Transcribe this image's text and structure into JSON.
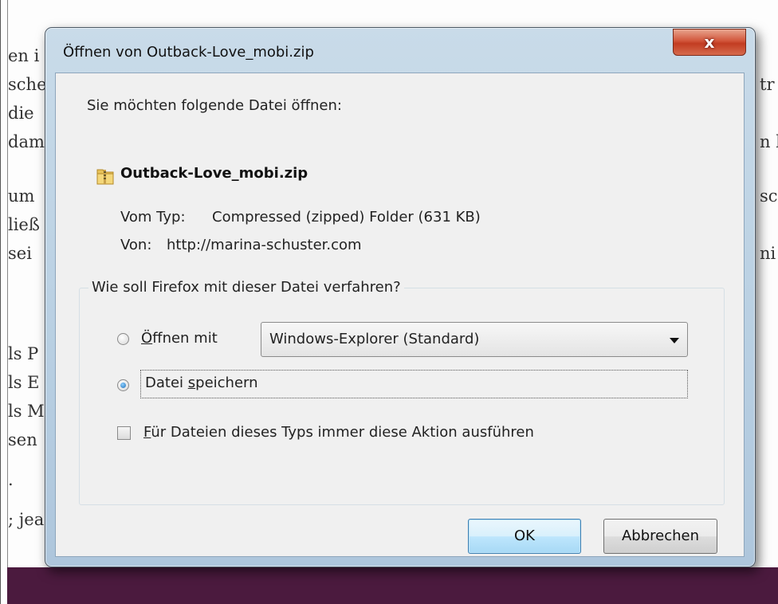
{
  "background": {
    "left_lines": [
      "en i",
      "sche",
      " die",
      "dam",
      "um",
      "ließ",
      " sei",
      "ls P",
      "ls E",
      "ls M",
      "sen",
      ".",
      "; jea"
    ],
    "right_lines": [
      "tr",
      "n l",
      "sc",
      "ni"
    ]
  },
  "dialog": {
    "title": "Öffnen von Outback-Love_mobi.zip",
    "prompt": "Sie möchten folgende Datei öffnen:",
    "file_name": "Outback-Love_mobi.zip",
    "type_label": "Vom Typ:",
    "type_value": "Compressed (zipped) Folder (631 KB)",
    "from_label": "Von:",
    "from_value": "http://marina-schuster.com",
    "question": "Wie soll Firefox mit dieser Datei verfahren?",
    "open_with": {
      "label_mnemonic": "Ö",
      "label_rest": "ffnen mit",
      "selected": false,
      "application": "Windows-Explorer (Standard)"
    },
    "save_file": {
      "label_pre": "Datei ",
      "label_mnemonic": "s",
      "label_rest": "peichern",
      "selected": true
    },
    "always": {
      "label_mnemonic": "F",
      "label_rest": "ür Dateien dieses Typs immer diese Aktion ausführen",
      "checked": false
    },
    "ok_label": "OK",
    "cancel_label": "Abbrechen"
  },
  "colors": {
    "footer": "#4b1a3e",
    "frame": "#b8cfe2",
    "close_button": "#c23c22"
  }
}
